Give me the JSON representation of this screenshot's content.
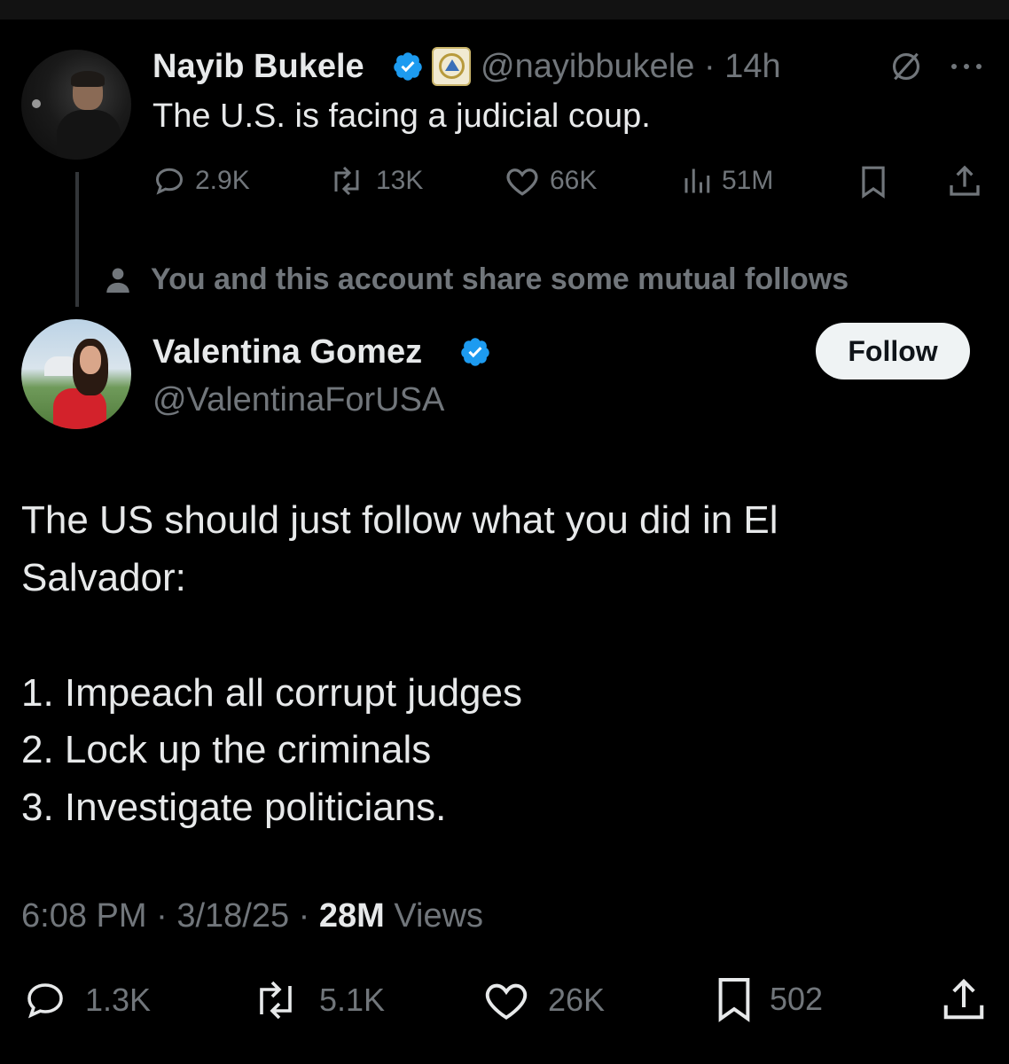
{
  "parent_tweet": {
    "author_name": "Nayib Bukele",
    "handle": "@nayibbukele",
    "separator": "·",
    "time": "14h",
    "text": "The U.S. is facing a judicial coup.",
    "replies": "2.9K",
    "reposts": "13K",
    "likes": "66K",
    "views": "51M"
  },
  "mutual_notice": "You and this account share some mutual follows",
  "main_tweet": {
    "author_name": "Valentina Gomez",
    "handle": "@ValentinaForUSA",
    "follow_label": "Follow",
    "text_lines": [
      "The US should just follow what you did in El",
      "Salvador:",
      "1. Impeach all corrupt judges",
      "2. Lock up the criminals",
      "3. Investigate politicians."
    ],
    "time": "6:08 PM",
    "date": "3/18/25",
    "views_count": "28M",
    "views_label": "Views",
    "separator": "·",
    "replies": "1.3K",
    "reposts": "5.1K",
    "likes": "26K",
    "bookmarks": "502"
  },
  "colors": {
    "background": "#000000",
    "text": "#e7e9ea",
    "muted": "#71767b",
    "verified": "#1d9bf0",
    "follow_button_bg": "#eff3f4"
  }
}
